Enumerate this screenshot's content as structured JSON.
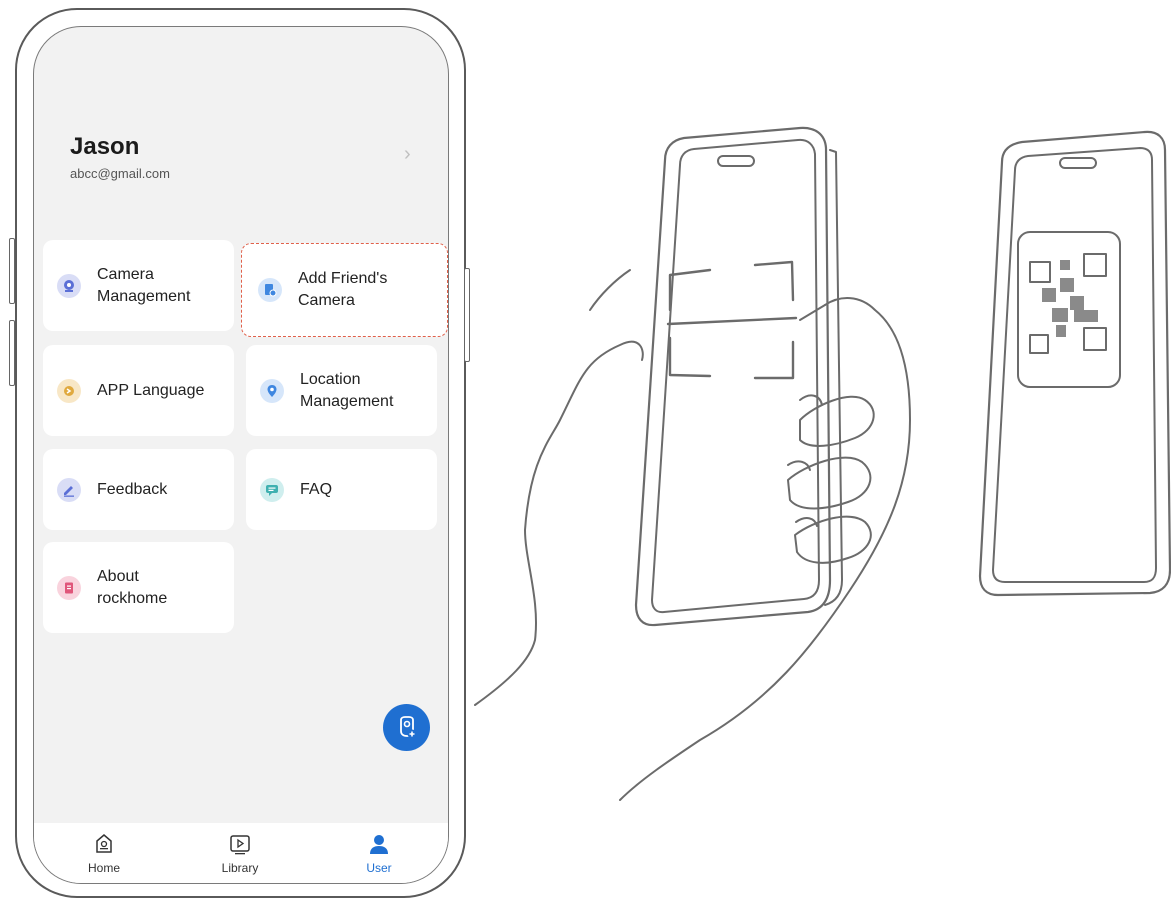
{
  "profile": {
    "name": "Jason",
    "email": "abcc@gmail.com"
  },
  "menu": [
    {
      "label": "Camera\nManagement",
      "icon": "camera-icon",
      "color": "#5b6fd6"
    },
    {
      "label": "Add Friend's\nCamera",
      "icon": "add-camera-icon",
      "color": "#3f87e0",
      "highlighted": true
    },
    {
      "label": "APP Language",
      "icon": "language-icon",
      "color": "#e0a93e"
    },
    {
      "label": "Location\nManagement",
      "icon": "location-pin-icon",
      "color": "#3f87e0"
    },
    {
      "label": "Feedback",
      "icon": "edit-pencil-icon",
      "color": "#5b6fd6"
    },
    {
      "label": "FAQ",
      "icon": "chat-icon",
      "color": "#3fb0b0"
    },
    {
      "label": "About\nrockhome",
      "icon": "book-icon",
      "color": "#e0567a"
    }
  ],
  "tabs": [
    {
      "label": "Home",
      "icon": "home-icon"
    },
    {
      "label": "Library",
      "icon": "play-icon"
    },
    {
      "label": "User",
      "icon": "user-icon",
      "active": true
    }
  ],
  "colors": {
    "accent": "#1f6fd1",
    "highlight_border": "#e0604a",
    "screen_bg": "#f2f2f2"
  }
}
